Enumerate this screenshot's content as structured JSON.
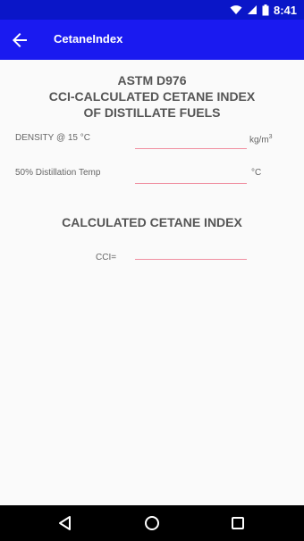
{
  "status_bar": {
    "time": "8:41"
  },
  "app_bar": {
    "title": "CetaneIndex"
  },
  "header": {
    "line1": "ASTM D976",
    "line2": "CCI-CALCULATED CETANE INDEX",
    "line3": "OF DISTILLATE FUELS"
  },
  "form": {
    "density": {
      "label": "DENSITY @ 15 °C",
      "value": "",
      "unit_base": "kg/m",
      "unit_exp": "3"
    },
    "distillation": {
      "label": "50% Distillation Temp",
      "value": "",
      "unit": "°C"
    }
  },
  "result": {
    "heading": "CALCULATED CETANE INDEX",
    "label": "CCI=",
    "value": ""
  },
  "icons": {
    "status": [
      "wifi-icon",
      "signal-icon",
      "battery-icon"
    ],
    "nav": [
      "back-triangle-icon",
      "home-circle-icon",
      "recents-square-icon"
    ]
  },
  "colors": {
    "status_bar": "#0a16c8",
    "app_bar": "#1a1af0",
    "field_underline": "#f08ea0",
    "nav_bar": "#000000"
  }
}
